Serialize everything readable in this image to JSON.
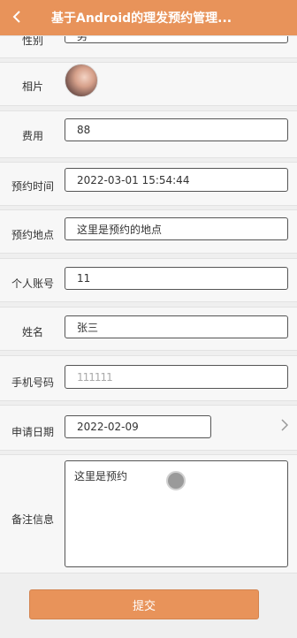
{
  "header": {
    "back_icon": "chevron-left-icon",
    "title": "基于Android的理发预约管理..."
  },
  "form": {
    "gender": {
      "label": "性别",
      "value": "男"
    },
    "photo": {
      "label": "相片"
    },
    "fee": {
      "label": "费用",
      "value": "88"
    },
    "appointment_time": {
      "label": "预约时间",
      "value": "2022-03-01 15:54:44"
    },
    "appointment_place": {
      "label": "预约地点",
      "value": "这里是预约的地点"
    },
    "account": {
      "label": "个人账号",
      "value": "11"
    },
    "name": {
      "label": "姓名",
      "value": "张三"
    },
    "phone": {
      "label": "手机号码",
      "value": "111111"
    },
    "apply_date": {
      "label": "申请日期",
      "value": "2022-02-09"
    },
    "remark": {
      "label": "备注信息",
      "value": "这里是预约"
    }
  },
  "submit_label": "提交",
  "colors": {
    "accent": "#e8935a"
  }
}
